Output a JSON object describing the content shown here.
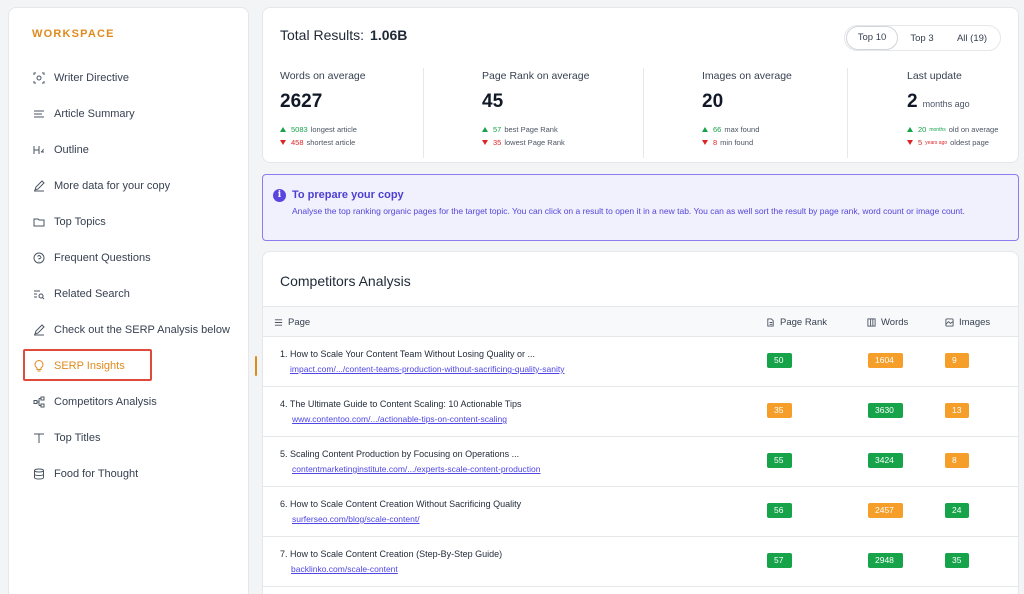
{
  "sidebar": {
    "title": "WORKSPACE",
    "items": [
      {
        "label": "Writer Directive",
        "icon": "target-icon"
      },
      {
        "label": "Article Summary",
        "icon": "lines-icon"
      },
      {
        "label": "Outline",
        "icon": "h2-icon"
      },
      {
        "label": "More data for your copy",
        "icon": "pencil-icon"
      },
      {
        "label": "Top Topics",
        "icon": "folder-icon"
      },
      {
        "label": "Frequent Questions",
        "icon": "question-icon"
      },
      {
        "label": "Related Search",
        "icon": "search-list-icon"
      },
      {
        "label": "Check out the SERP Analysis below",
        "icon": "pencil-icon"
      },
      {
        "label": "SERP Insights",
        "icon": "bulb-icon",
        "active": true
      },
      {
        "label": "Competitors Analysis",
        "icon": "hierarchy-icon"
      },
      {
        "label": "Top Titles",
        "icon": "text-icon"
      },
      {
        "label": "Food for Thought",
        "icon": "database-icon"
      }
    ]
  },
  "stats": {
    "total_label": "Total Results:",
    "total_value": "1.06B",
    "tabs": [
      "Top 10",
      "Top 3",
      "All (19)"
    ],
    "words": {
      "label": "Words on average",
      "value": "2627",
      "max_num": "5083",
      "max_text": "longest article",
      "min_num": "458",
      "min_text": "shortest article"
    },
    "rank": {
      "label": "Page Rank on average",
      "value": "45",
      "max_num": "57",
      "max_text": "best Page Rank",
      "min_num": "35",
      "min_text": "lowest Page Rank"
    },
    "images": {
      "label": "Images on average",
      "value": "20",
      "max_num": "66",
      "max_text": "max found",
      "min_num": "8",
      "min_text": "min found"
    },
    "update": {
      "label": "Last update",
      "value": "2",
      "unit": "months ago",
      "max_num": "20",
      "max_small": "months",
      "max_text": "old on average",
      "min_num": "5",
      "min_small": "years ago",
      "min_text": "oldest page"
    }
  },
  "info": {
    "title": "To prepare your copy",
    "text": "Analyse the top ranking organic pages for the target topic. You can click on a result to open it in a new tab. You can as well sort the result by page rank, word count or image count."
  },
  "competitors": {
    "title": "Competitors Analysis",
    "headers": {
      "page": "Page",
      "rank": "Page Rank",
      "words": "Words",
      "images": "Images"
    },
    "rows": [
      {
        "title": "1.  How to Scale Your Content Team Without Losing Quality or ...",
        "url": "impact.com/.../content-teams-production-without-sacrificing-quality-sanity",
        "rank": "50",
        "words": "1604",
        "images": "9",
        "rank_color": "green",
        "words_color": "orange",
        "images_color": "orange"
      },
      {
        "title": "4.  The Ultimate Guide to Content Scaling: 10 Actionable Tips",
        "url": "www.contentoo.com/.../actionable-tips-on-content-scaling",
        "rank": "35",
        "words": "3630",
        "images": "13",
        "rank_color": "orange",
        "words_color": "green",
        "images_color": "orange"
      },
      {
        "title": "5.  Scaling Content Production by Focusing on Operations ...",
        "url": "contentmarketinginstitute.com/.../experts-scale-content-production",
        "rank": "55",
        "words": "3424",
        "images": "8",
        "rank_color": "green",
        "words_color": "green",
        "images_color": "orange"
      },
      {
        "title": "6.  How to Scale Content Creation Without Sacrificing Quality",
        "url": "surferseo.com/blog/scale-content/",
        "rank": "56",
        "words": "2457",
        "images": "24",
        "rank_color": "green",
        "words_color": "orange",
        "images_color": "green"
      },
      {
        "title": "7.  How to Scale Content Creation (Step-By-Step Guide)",
        "url": "backlinko.com/scale-content",
        "rank": "57",
        "words": "2948",
        "images": "35",
        "rank_color": "green",
        "words_color": "green",
        "images_color": "green"
      }
    ]
  },
  "colors": {
    "accent": "#e08a1e",
    "green": "#16a34a",
    "orange": "#f59e2a",
    "info": "#5b45e0",
    "highlight": "#e04a3a"
  }
}
